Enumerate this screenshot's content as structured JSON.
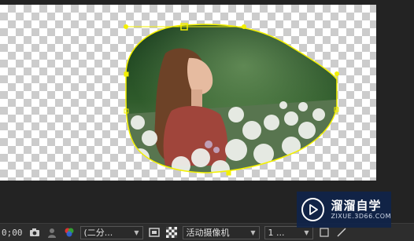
{
  "viewer": {
    "layer_image": "woman-in-flower-field-photo",
    "mask_color": "#f3f000"
  },
  "toolbar": {
    "timecode": "0;00",
    "resolution": "(二分...",
    "camera": "活动摄像机",
    "views": "1 ..."
  },
  "watermark": {
    "title": "溜溜自学",
    "url": "ZIXUE.3D66.COM"
  },
  "colors": {
    "panel_bg": "#232323",
    "toolbar_bg": "#2d2d2d",
    "mask_path": "#f3f000",
    "watermark_bg": "#0f234b"
  }
}
